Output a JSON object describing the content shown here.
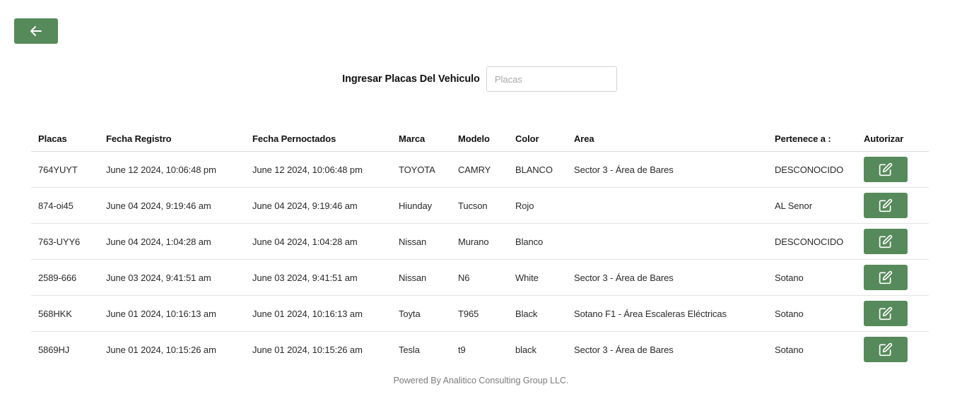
{
  "nav": {
    "back_icon": "arrow-left-icon"
  },
  "search": {
    "label": "Ingresar Placas Del Vehiculo",
    "placeholder": "Placas",
    "value": ""
  },
  "table": {
    "headers": [
      "Placas",
      "Fecha Registro",
      "Fecha Pernoctados",
      "Marca",
      "Modelo",
      "Color",
      "Area",
      "Pertenece a :",
      "Autorizar"
    ],
    "rows": [
      {
        "placas": "764YUYT",
        "fecha_registro": "June 12 2024, 10:06:48 pm",
        "fecha_pernoctados": "June 12 2024, 10:06:48 pm",
        "marca": "TOYOTA",
        "modelo": "CAMRY",
        "color": "BLANCO",
        "area": "Sector 3 - Área de Bares",
        "pertenece": "DESCONOCIDO"
      },
      {
        "placas": "874-oi45",
        "fecha_registro": "June 04 2024, 9:19:46 am",
        "fecha_pernoctados": "June 04 2024, 9:19:46 am",
        "marca": "Hiunday",
        "modelo": "Tucson",
        "color": "Rojo",
        "area": "",
        "pertenece": "AL Senor"
      },
      {
        "placas": "763-UYY6",
        "fecha_registro": "June 04 2024, 1:04:28 am",
        "fecha_pernoctados": "June 04 2024, 1:04:28 am",
        "marca": "Nissan",
        "modelo": "Murano",
        "color": "Blanco",
        "area": "",
        "pertenece": "DESCONOCIDO"
      },
      {
        "placas": "2589-666",
        "fecha_registro": "June 03 2024, 9:41:51 am",
        "fecha_pernoctados": "June 03 2024, 9:41:51 am",
        "marca": "Nissan",
        "modelo": "N6",
        "color": "White",
        "area": "Sector 3 - Área de Bares",
        "pertenece": "Sotano"
      },
      {
        "placas": "568HKK",
        "fecha_registro": "June 01 2024, 10:16:13 am",
        "fecha_pernoctados": "June 01 2024, 10:16:13 am",
        "marca": "Toyta",
        "modelo": "T965",
        "color": "Black",
        "area": "Sotano F1 - Área Escaleras Eléctricas",
        "pertenece": "Sotano"
      },
      {
        "placas": "5869HJ",
        "fecha_registro": "June 01 2024, 10:15:26 am",
        "fecha_pernoctados": "June 01 2024, 10:15:26 am",
        "marca": "Tesla",
        "modelo": "t9",
        "color": "black",
        "area": "Sector 3 - Área de Bares",
        "pertenece": "Sotano"
      }
    ],
    "authorize_icon": "edit-icon"
  },
  "footer": {
    "text": "Powered By Analitico Consulting Group LLC."
  },
  "colors": {
    "accent": "#568a5a",
    "border": "#e2e2e2",
    "footer_text": "#7b7b7b"
  }
}
